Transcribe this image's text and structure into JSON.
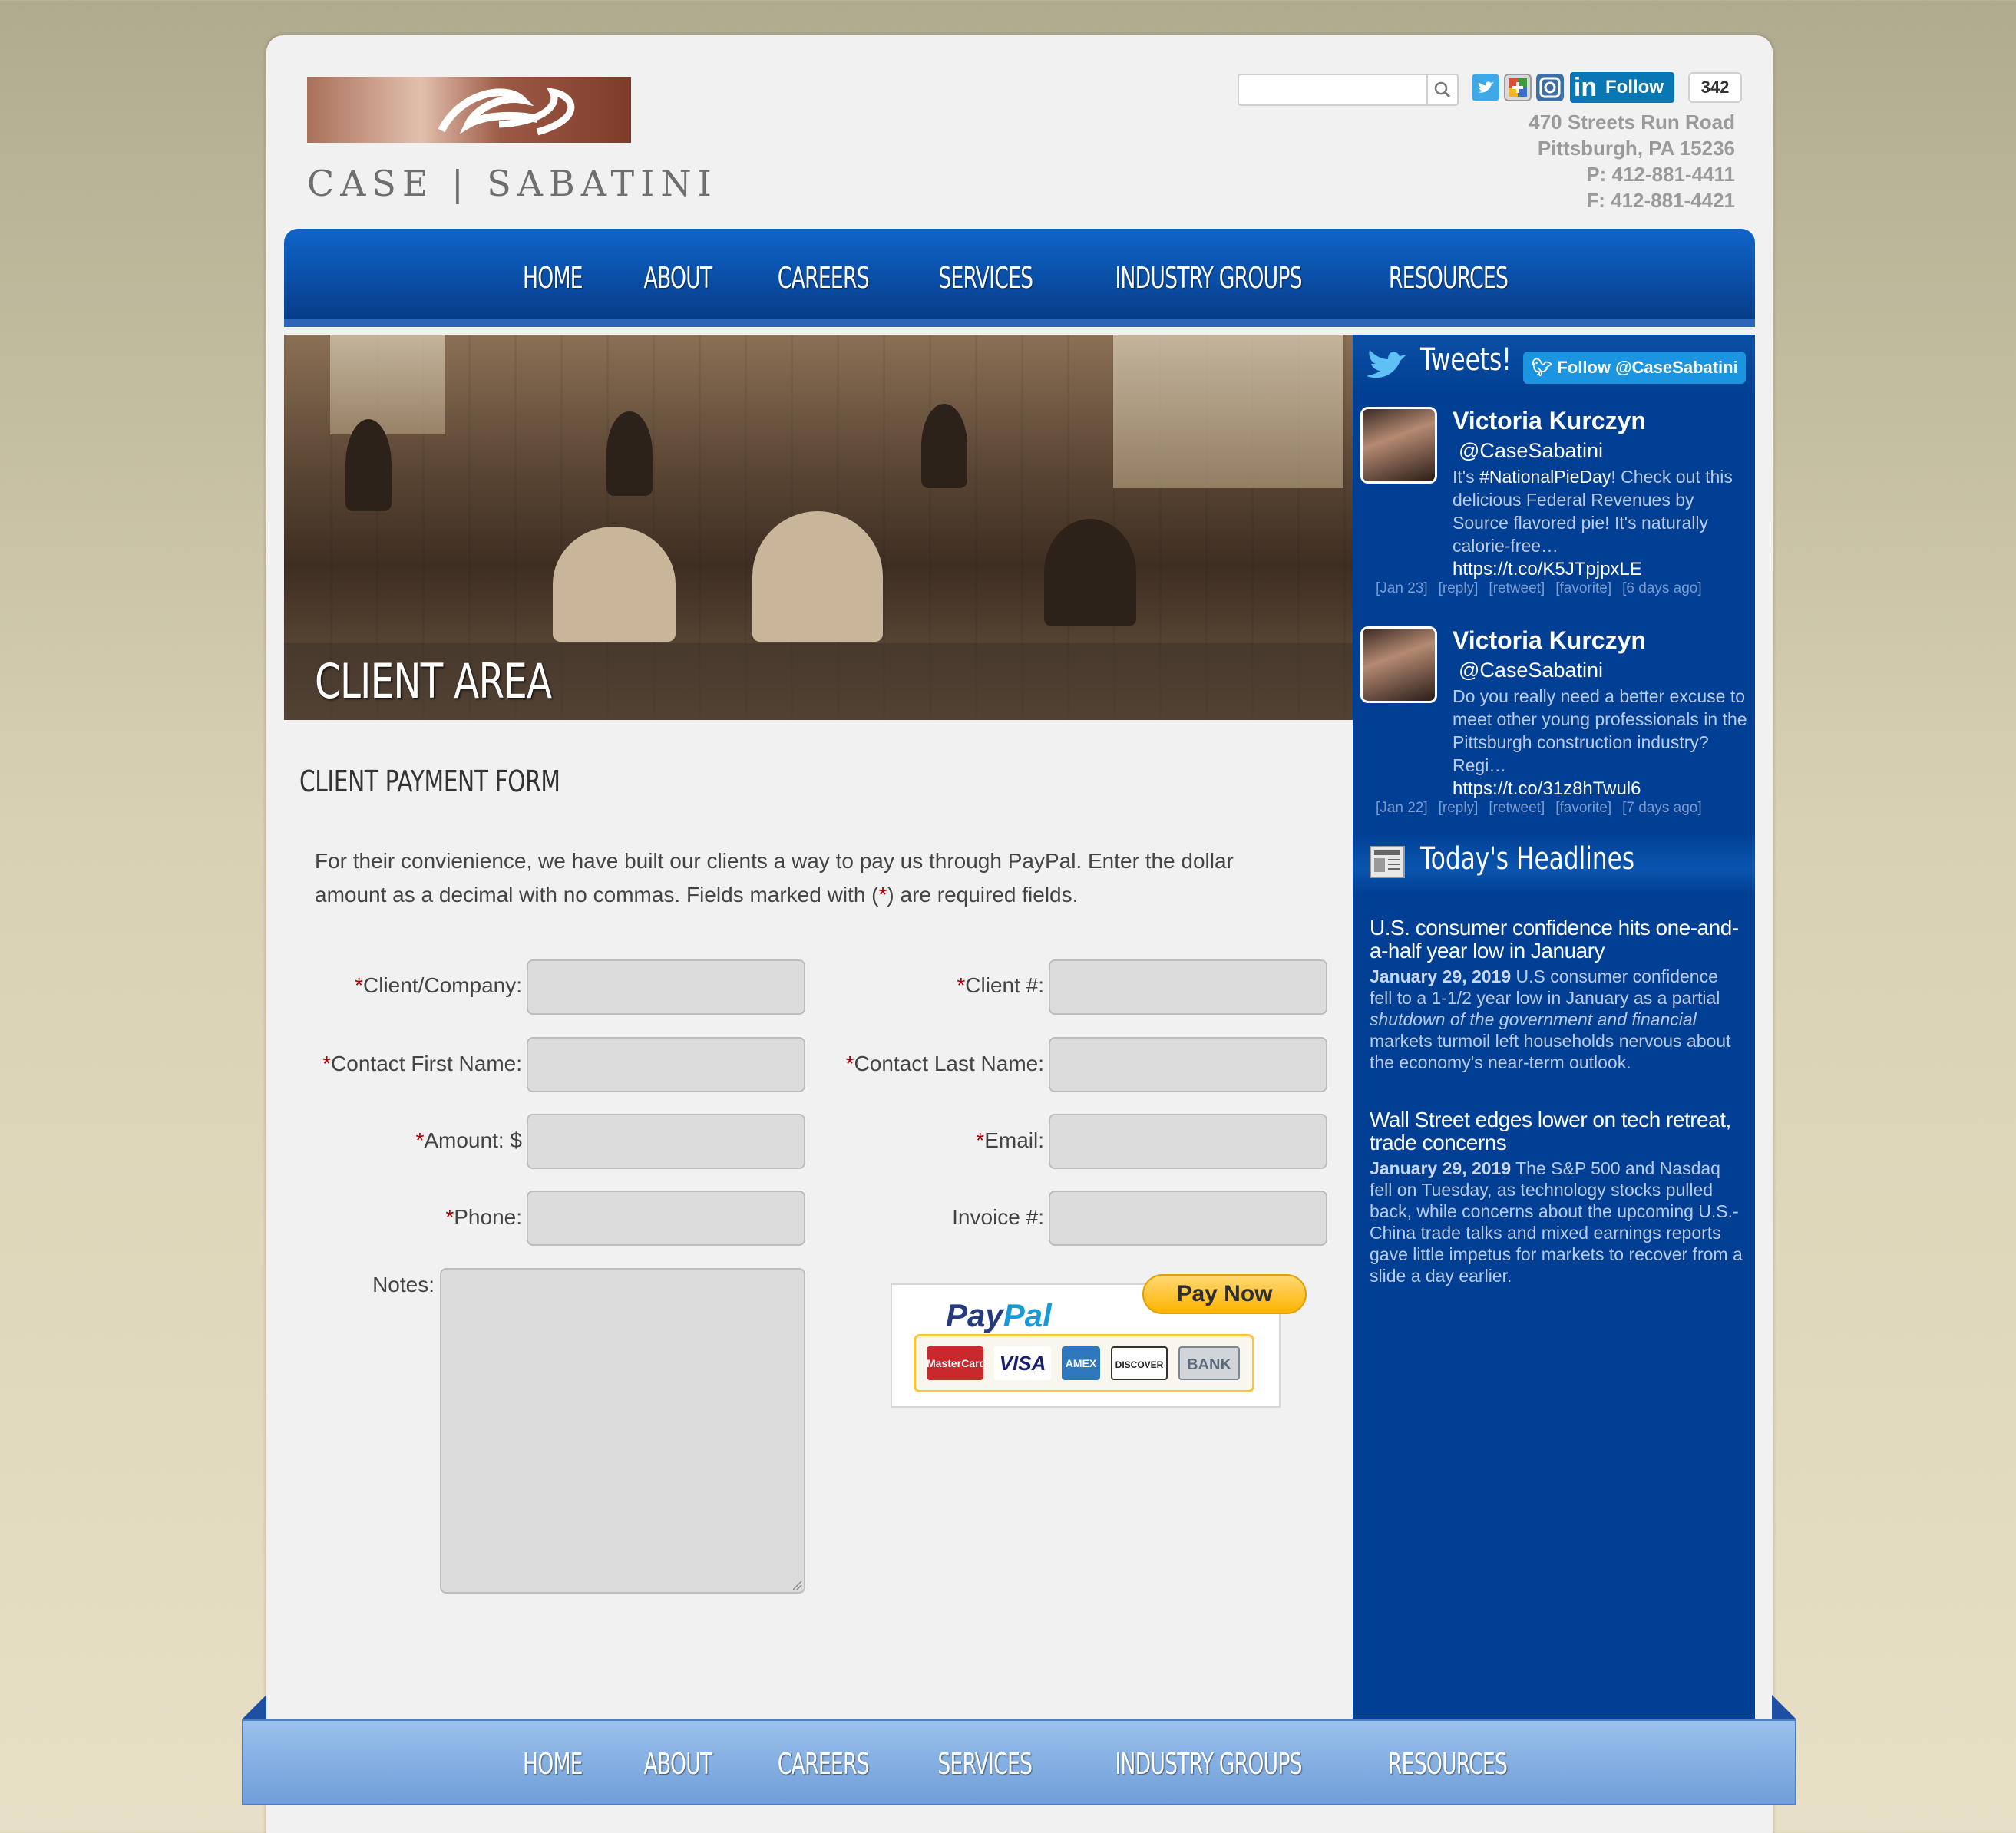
{
  "header": {
    "logo_text": "CASE | SABATINI",
    "search": {
      "placeholder": ""
    },
    "social": [
      "twitter-icon",
      "google-plus-icon",
      "instagram-icon"
    ],
    "linkedin": {
      "logo": "in",
      "label": "Follow",
      "count": "342"
    },
    "address": {
      "line1": "470 Streets Run Road",
      "line2": "Pittsburgh, PA 15236",
      "phone": "P: 412-881-4411",
      "fax": "F: 412-881-4421"
    }
  },
  "nav": {
    "items": [
      "HOME",
      "ABOUT",
      "CAREERS",
      "SERVICES",
      "INDUSTRY GROUPS",
      "RESOURCES"
    ]
  },
  "hero": {
    "title": "CLIENT AREA"
  },
  "main": {
    "heading": "CLIENT PAYMENT FORM",
    "intro_1": "For their convienience, we have built our clients a way to pay us through PayPal. Enter the dollar amount as a decimal with no commas. Fields marked with (",
    "intro_req": "*",
    "intro_2": ") are required fields.",
    "fields": {
      "client_company": "Client/Company:",
      "client_number": "Client #:",
      "first_name": "Contact First Name:",
      "last_name": "Contact Last Name:",
      "amount": "Amount: $",
      "email": "Email:",
      "phone": "Phone:",
      "invoice": "Invoice #:",
      "notes": "Notes:"
    },
    "required_mark": "*",
    "paypal": {
      "pay_label": "Pay Now",
      "logo_pay": "Pay",
      "logo_pal": "Pal",
      "cards": [
        "MasterCard",
        "VISA",
        "AMEX",
        "DISCOVER",
        "BANK"
      ]
    }
  },
  "sidebar": {
    "tweets_title": "Tweets!",
    "follow_label": "Follow @CaseSabatini",
    "tweets": [
      {
        "name": "Victoria Kurczyn",
        "handle": "@CaseSabatini",
        "pre": "It's ",
        "hashtag": "#NationalPieDay",
        "text": "! Check out this delicious Federal Revenues by Source flavored pie! It's naturally calorie-free…",
        "link": "https://t.co/K5JTpjpxLE",
        "date": "[Jan 23]",
        "reply": "[reply]",
        "retweet": "[retweet]",
        "favorite": "[favorite]",
        "ago": "[6 days ago]"
      },
      {
        "name": "Victoria Kurczyn",
        "handle": "@CaseSabatini",
        "pre": "",
        "hashtag": "",
        "text": "Do you really need a better excuse to meet other young professionals in the Pittsburgh construction industry? Regi…",
        "link": "https://t.co/31z8hTwul6",
        "date": "[Jan 22]",
        "reply": "[reply]",
        "retweet": "[retweet]",
        "favorite": "[favorite]",
        "ago": "[7 days ago]"
      }
    ],
    "headlines_title": "Today's Headlines",
    "headlines": [
      {
        "title": "U.S. consumer confidence hits one-and-a-half year low in January",
        "date": "January 29, 2019",
        "body_1": " U.S consumer confidence fell to a 1-1/2 year low in January as a partial ",
        "body_italic": "shutdown of the government and financial",
        "body_2": " markets turmoil left households nervous about the economy's near-term outlook."
      },
      {
        "title": "Wall Street edges lower on tech retreat, trade concerns",
        "date": "January 29, 2019",
        "body_1": " The S&P 500 and Nasdaq fell on Tuesday, as technology stocks pulled back, while concerns about the upcoming U.S.-China trade talks and mixed earnings reports gave little impetus for markets to recover from a slide a day earlier.",
        "body_italic": "",
        "body_2": ""
      }
    ]
  },
  "footer": {
    "nav": [
      "HOME",
      "ABOUT",
      "CAREERS",
      "SERVICES",
      "INDUSTRY GROUPS",
      "RESOURCES"
    ]
  },
  "colors": {
    "nav_blue": "#0a4fa8",
    "sidebar_blue": "#003f93",
    "footer_blue": "#7aa8e0",
    "required_red": "#a10000"
  }
}
